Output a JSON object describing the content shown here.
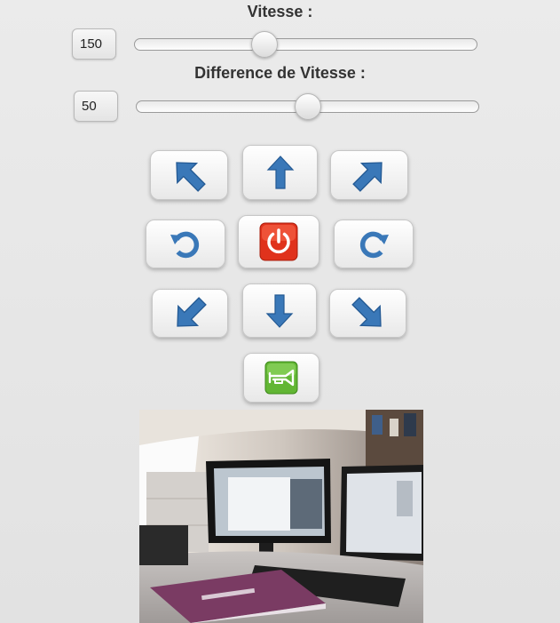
{
  "controls": {
    "speed": {
      "label": "Vitesse :",
      "value": "150",
      "level": 0.37
    },
    "speed_difference": {
      "label": "Difference de Vitesse :",
      "value": "50",
      "level": 0.5
    }
  },
  "pad": {
    "buttons": [
      {
        "name": "forward-left-button",
        "icon": "arrow-up-left-icon"
      },
      {
        "name": "forward-button",
        "icon": "arrow-up-icon"
      },
      {
        "name": "forward-right-button",
        "icon": "arrow-up-right-icon"
      },
      {
        "name": "rotate-left-button",
        "icon": "rotate-ccw-icon"
      },
      {
        "name": "stop-button",
        "icon": "power-icon"
      },
      {
        "name": "rotate-right-button",
        "icon": "rotate-cw-icon"
      },
      {
        "name": "backward-left-button",
        "icon": "arrow-down-left-icon"
      },
      {
        "name": "backward-button",
        "icon": "arrow-down-icon"
      },
      {
        "name": "backward-right-button",
        "icon": "arrow-down-right-icon"
      },
      {
        "name": "horn-button",
        "icon": "horn-icon"
      }
    ]
  },
  "colors": {
    "arrow_blue": "#3a78b8",
    "stop_red": "#e0321c",
    "horn_green": "#62b634"
  }
}
